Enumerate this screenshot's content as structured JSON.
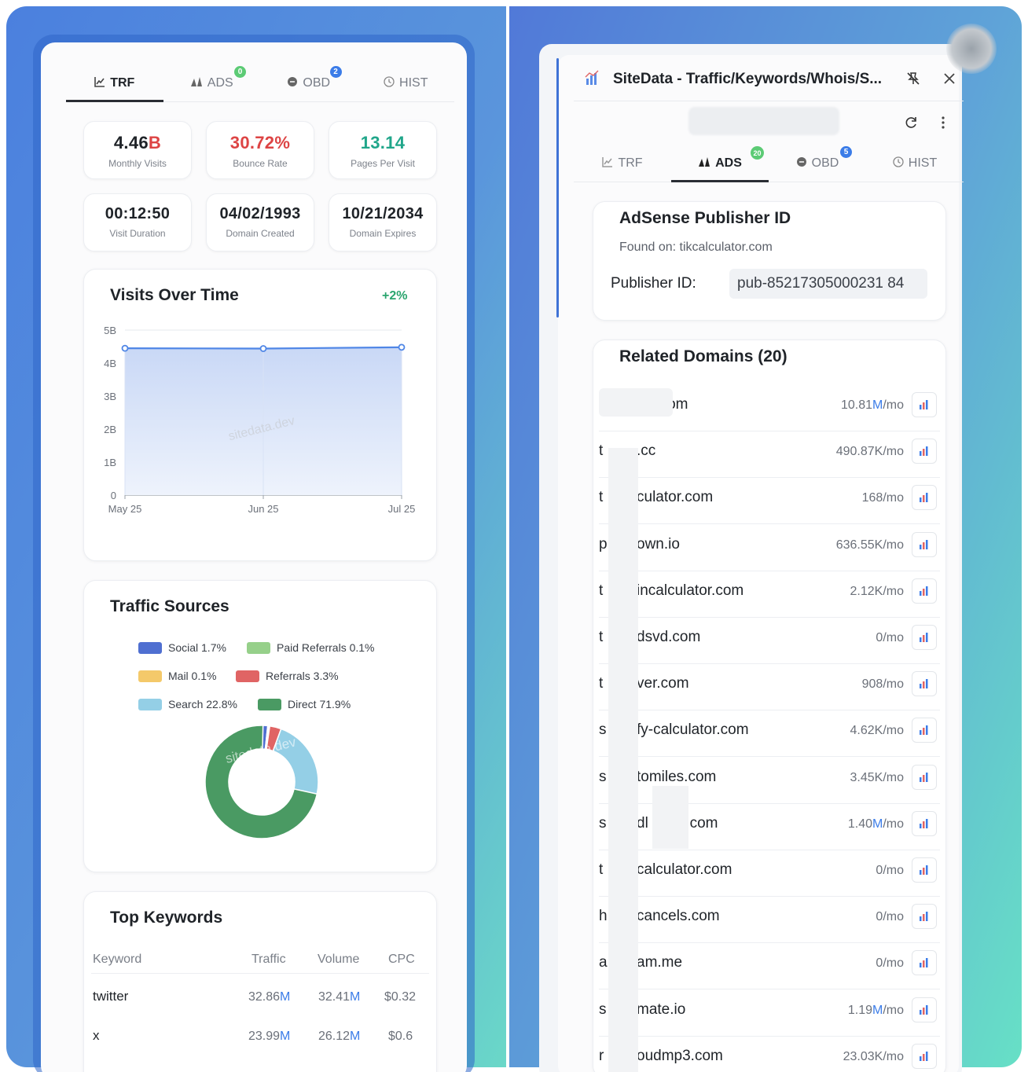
{
  "left": {
    "tabs": [
      {
        "label": "TRF",
        "icon": "chart-line-icon",
        "active": true
      },
      {
        "label": "ADS",
        "icon": "ads-icon",
        "badge": "0",
        "badge_color": "#5ccb75"
      },
      {
        "label": "OBD",
        "icon": "obd-icon",
        "badge": "2",
        "badge_color": "#3b7ce8"
      },
      {
        "label": "HIST",
        "icon": "clock-icon"
      }
    ],
    "stats": [
      {
        "value_main": "4.46",
        "value_unit": "B",
        "label": "Monthly Visits"
      },
      {
        "value": "30.72%",
        "label": "Bounce Rate",
        "color": "#dd4444"
      },
      {
        "value": "13.14",
        "label": "Pages Per Visit",
        "color": "#20a68a"
      },
      {
        "value": "00:12:50",
        "label": "Visit Duration"
      },
      {
        "value": "04/02/1993",
        "label": "Domain Created"
      },
      {
        "value": "10/21/2034",
        "label": "Domain Expires"
      }
    ],
    "visits": {
      "title": "Visits Over Time",
      "change": "+2%",
      "watermark": "sitedata.dev"
    },
    "traffic": {
      "title": "Traffic Sources",
      "watermark": "sitedata.dev"
    },
    "keywords": {
      "title": "Top Keywords",
      "headers": [
        "Keyword",
        "Traffic",
        "Volume",
        "CPC"
      ],
      "rows": [
        {
          "keyword": "twitter",
          "traffic_n": "32.86",
          "traffic_u": "M",
          "volume_n": "32.41",
          "volume_u": "M",
          "cpc": "$0.32"
        },
        {
          "keyword": "x",
          "traffic_n": "23.99",
          "traffic_u": "M",
          "volume_n": "26.12",
          "volume_u": "M",
          "cpc": "$0.6"
        }
      ]
    }
  },
  "chart_data": [
    {
      "type": "area",
      "title": "Visits Over Time",
      "categories": [
        "May 25",
        "Jun 25",
        "Jul 25"
      ],
      "values": [
        4.45,
        4.44,
        4.48
      ],
      "yticks": [
        "0",
        "1B",
        "2B",
        "3B",
        "4B",
        "5B"
      ],
      "ylim": [
        0,
        5
      ],
      "grid": true,
      "color": "#4f86e6"
    },
    {
      "type": "pie",
      "title": "Traffic Sources",
      "labels": [
        "Social 1.7%",
        "Paid Referrals 0.1%",
        "Mail 0.1%",
        "Referrals 3.3%",
        "Search 22.8%",
        "Direct 71.9%"
      ],
      "values": [
        1.7,
        0.1,
        0.1,
        3.3,
        22.8,
        71.9
      ],
      "colors": [
        "#4f6fd1",
        "#96d08a",
        "#f4c96a",
        "#e06464",
        "#94cfe6",
        "#4a9a63"
      ],
      "legend_position": "top"
    }
  ],
  "right": {
    "title": "SiteData - Traffic/Keywords/Whois/S...",
    "tabs": [
      {
        "label": "TRF",
        "icon": "chart-line-icon"
      },
      {
        "label": "ADS",
        "icon": "ads-icon",
        "active": true,
        "badge": "20",
        "badge_color": "#5ccb75"
      },
      {
        "label": "OBD",
        "icon": "obd-icon",
        "badge": "5",
        "badge_color": "#3b7ce8"
      },
      {
        "label": "HIST",
        "icon": "clock-icon"
      }
    ],
    "adsense": {
      "title": "AdSense Publisher ID",
      "found_on": "Found on: tikcalculator.com",
      "publisher_label": "Publisher ID:",
      "publisher_value": "pub-85217305000231 84"
    },
    "related": {
      "title": "Related Domains (20)",
      "rows": [
        {
          "prefix": "",
          "name": "wn.com",
          "tn": "10.81",
          "tu": "M",
          "tr": "/mo",
          "hl": true
        },
        {
          "prefix": "t",
          "name": ".cc",
          "tn": "490.87",
          "tu": "K",
          "tr": "/mo",
          "hl": false
        },
        {
          "prefix": "t",
          "name": "culator.com",
          "tn": "168",
          "tu": "",
          "tr": "/mo",
          "hl": false
        },
        {
          "prefix": "p",
          "name": "own.io",
          "tn": "636.55",
          "tu": "K",
          "tr": "/mo",
          "hl": false
        },
        {
          "prefix": "t",
          "name": "incalculator.com",
          "tn": "2.12",
          "tu": "K",
          "tr": "/mo",
          "hl": false
        },
        {
          "prefix": "t",
          "name": "dsvd.com",
          "tn": "0",
          "tu": "",
          "tr": "/mo",
          "hl": false
        },
        {
          "prefix": "t",
          "name": "ver.com",
          "tn": "908",
          "tu": "",
          "tr": "/mo",
          "hl": false
        },
        {
          "prefix": "s",
          "name": "fy-calculator.com",
          "tn": "4.62",
          "tu": "K",
          "tr": "/mo",
          "hl": false
        },
        {
          "prefix": "s",
          "name": "tomiles.com",
          "tn": "3.45",
          "tu": "K",
          "tr": "/mo",
          "hl": false
        },
        {
          "prefix": "s",
          "name": "dl    ate.com",
          "tn": "1.40",
          "tu": "M",
          "tr": "/mo",
          "hl": true
        },
        {
          "prefix": "t",
          "name": "calculator.com",
          "tn": "0",
          "tu": "",
          "tr": "/mo",
          "hl": false
        },
        {
          "prefix": "h",
          "name": "cancels.com",
          "tn": "0",
          "tu": "",
          "tr": "/mo",
          "hl": false
        },
        {
          "prefix": "a",
          "name": "am.me",
          "tn": "0",
          "tu": "",
          "tr": "/mo",
          "hl": false
        },
        {
          "prefix": "s",
          "name": "mate.io",
          "tn": "1.19",
          "tu": "M",
          "tr": "/mo",
          "hl": true
        },
        {
          "prefix": "r",
          "name": "oudmp3.com",
          "tn": "23.03",
          "tu": "K",
          "tr": "/mo",
          "hl": false
        }
      ]
    }
  }
}
